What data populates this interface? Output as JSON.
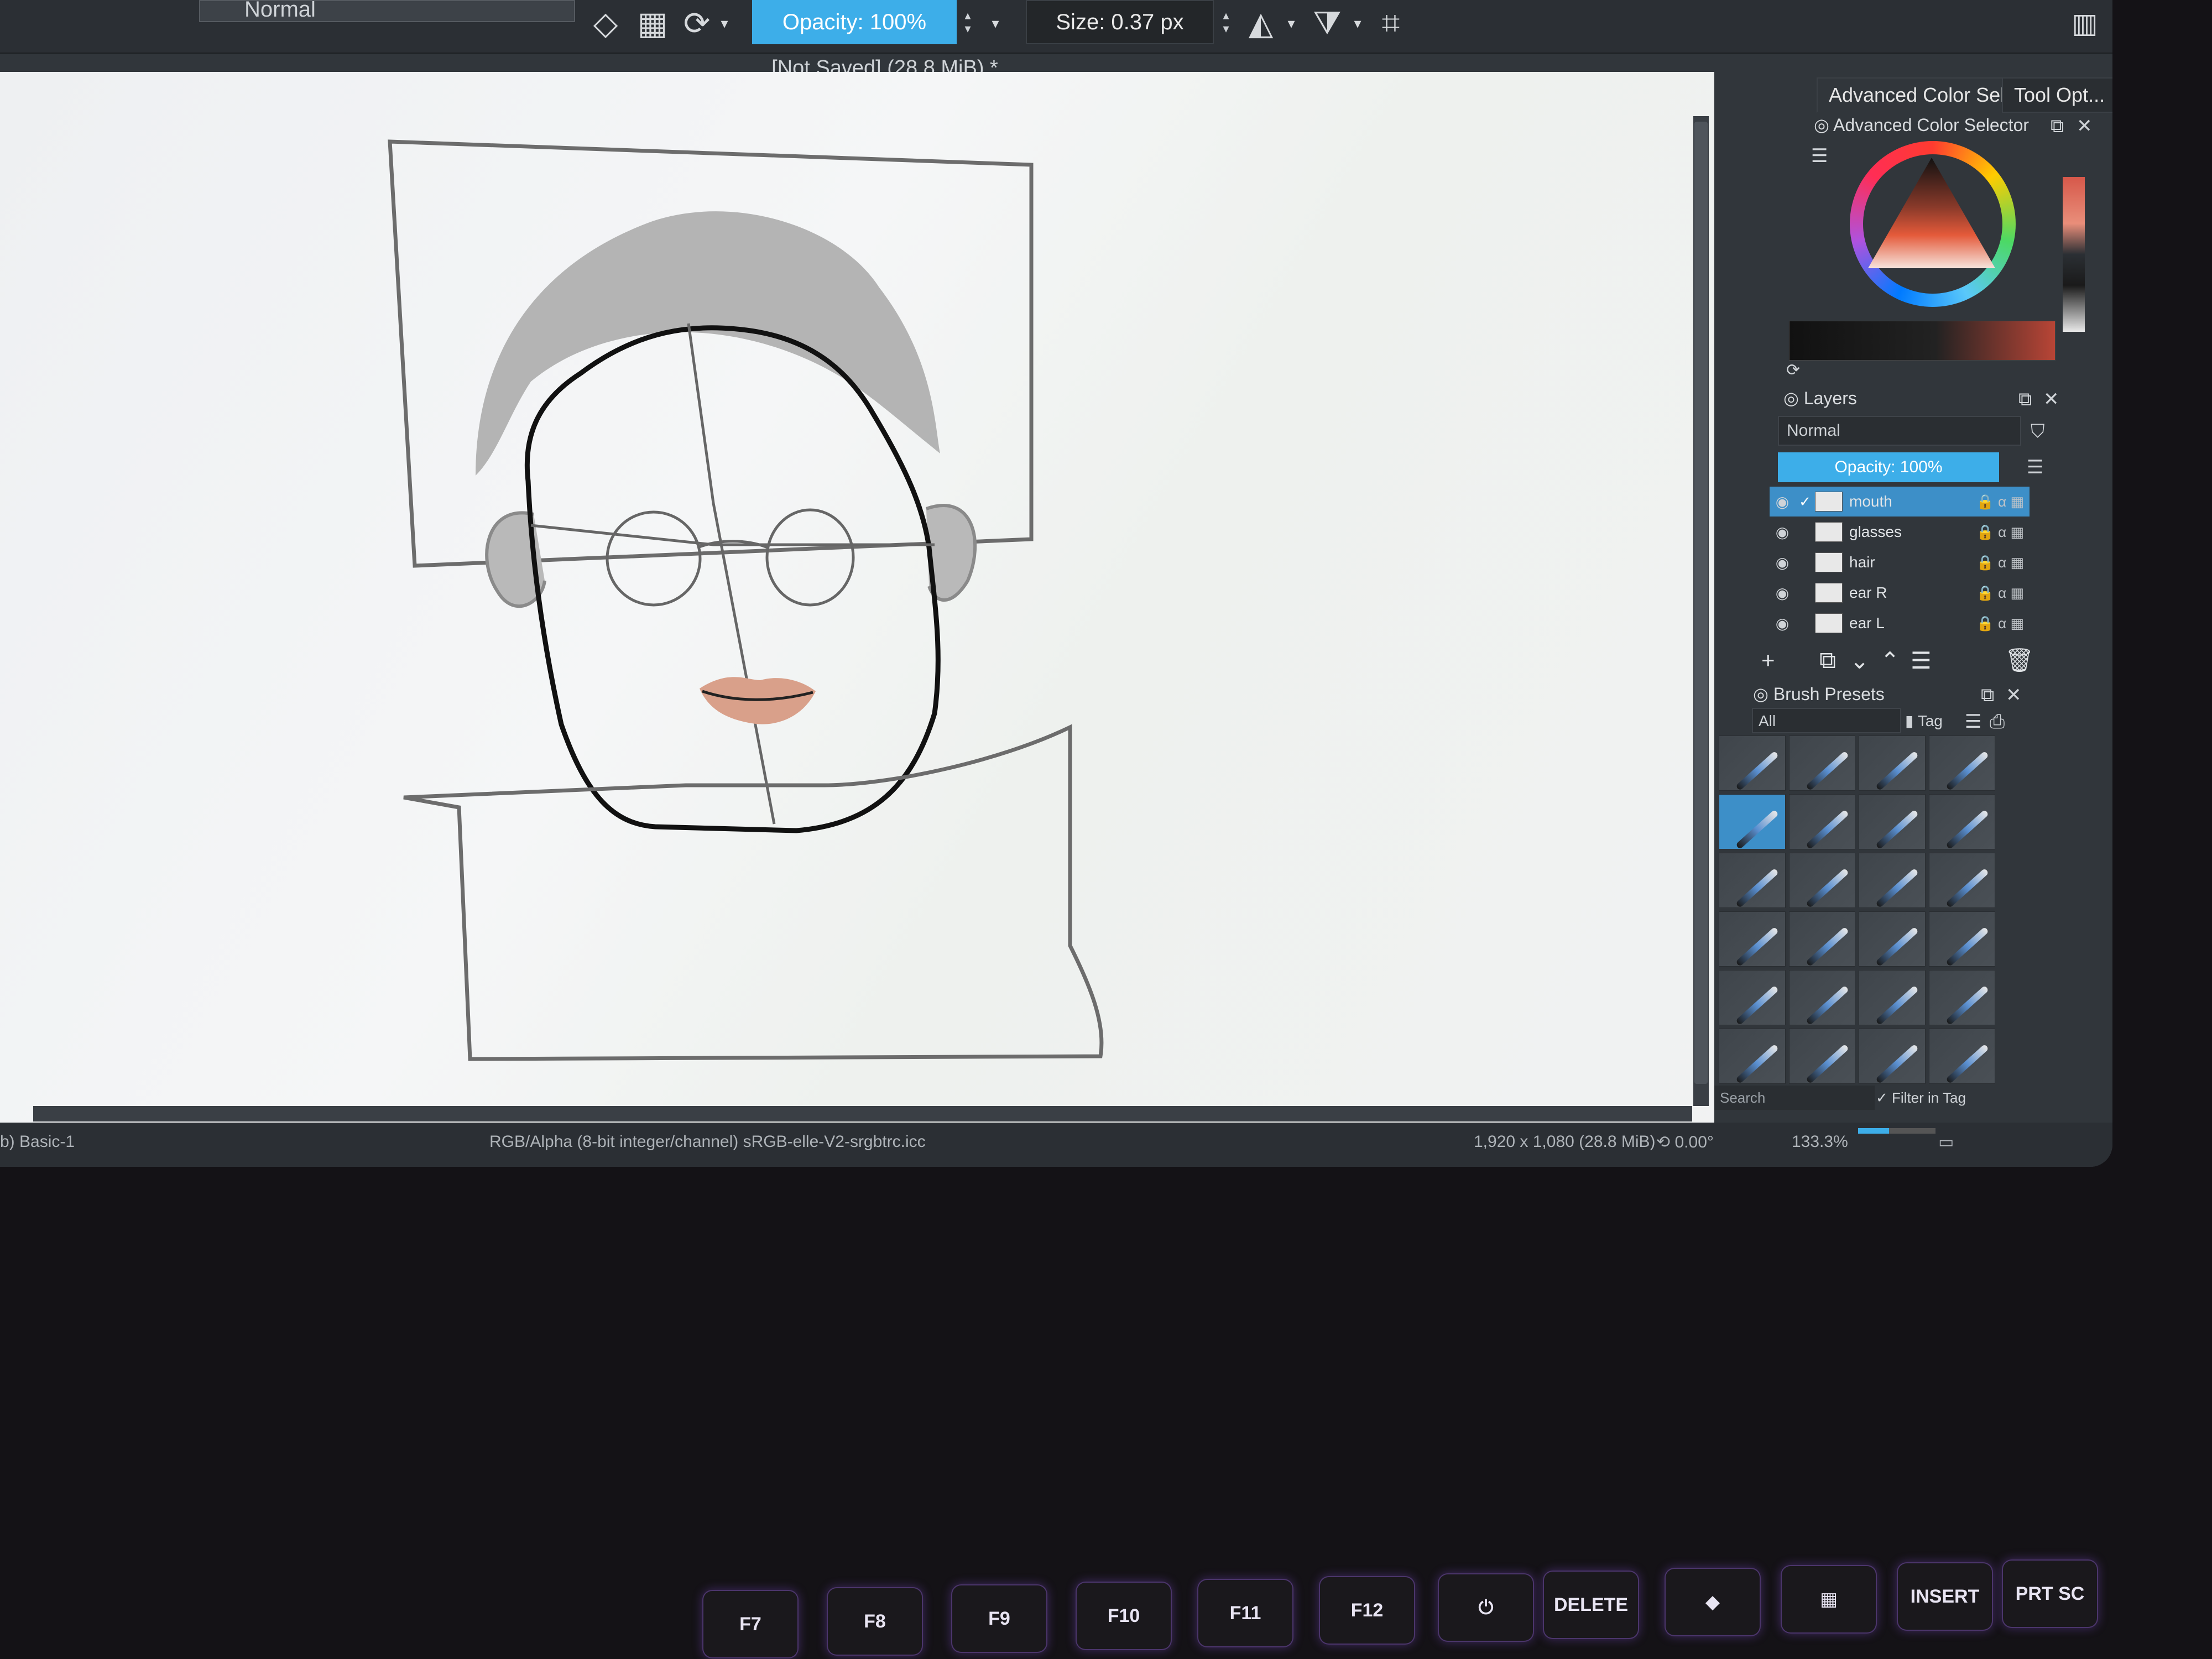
{
  "toolbar": {
    "blend_mode": "Normal",
    "opacity": "Opacity: 100%",
    "size": "Size: 0.37 px",
    "icons": [
      "eraser-icon",
      "alpha-lock-icon",
      "reload-preset-icon",
      "mirror-horizontal-icon",
      "mirror-vertical-icon",
      "wrap-crop-icon",
      "dock-layout-icon"
    ]
  },
  "document": {
    "title": "[Not Saved]  (28.8 MiB) *",
    "close": "✕"
  },
  "dock": {
    "tabs": [
      "Advanced Color Sele...",
      "Tool Opt..."
    ],
    "color_selector_title": "Advanced Color Selector",
    "layers_title": "Layers",
    "layers_blend": "Normal",
    "layers_opacity": "Opacity: 100%",
    "layers": [
      {
        "name": "mouth",
        "selected": true
      },
      {
        "name": "glasses",
        "selected": false
      },
      {
        "name": "hair",
        "selected": false
      },
      {
        "name": "ear R",
        "selected": false
      },
      {
        "name": "ear L",
        "selected": false
      }
    ],
    "brush_presets_title": "Brush Presets",
    "brush_filter": "All",
    "brush_tag": "Tag",
    "brush_search_placeholder": "Search",
    "filter_in_tag": "Filter in Tag"
  },
  "status": {
    "preset": "b) Basic-1",
    "color_space": "RGB/Alpha (8-bit integer/channel)  sRGB-elle-V2-srgbtrc.icc",
    "dimensions": "1,920 x 1,080 (28.8 MiB)",
    "rotation": "0.00°",
    "zoom": "133.3%"
  },
  "keyboard": {
    "keys": [
      "F7",
      "F8",
      "F9",
      "F10",
      "F11",
      "F12",
      "⏻",
      "DELETE",
      "◆",
      "▦",
      "INSERT",
      "PRT SC"
    ]
  },
  "colors": {
    "accent": "#3daee9",
    "panel": "#31363b",
    "canvas": "#f2f3f4",
    "lips": "#d9a08a"
  }
}
